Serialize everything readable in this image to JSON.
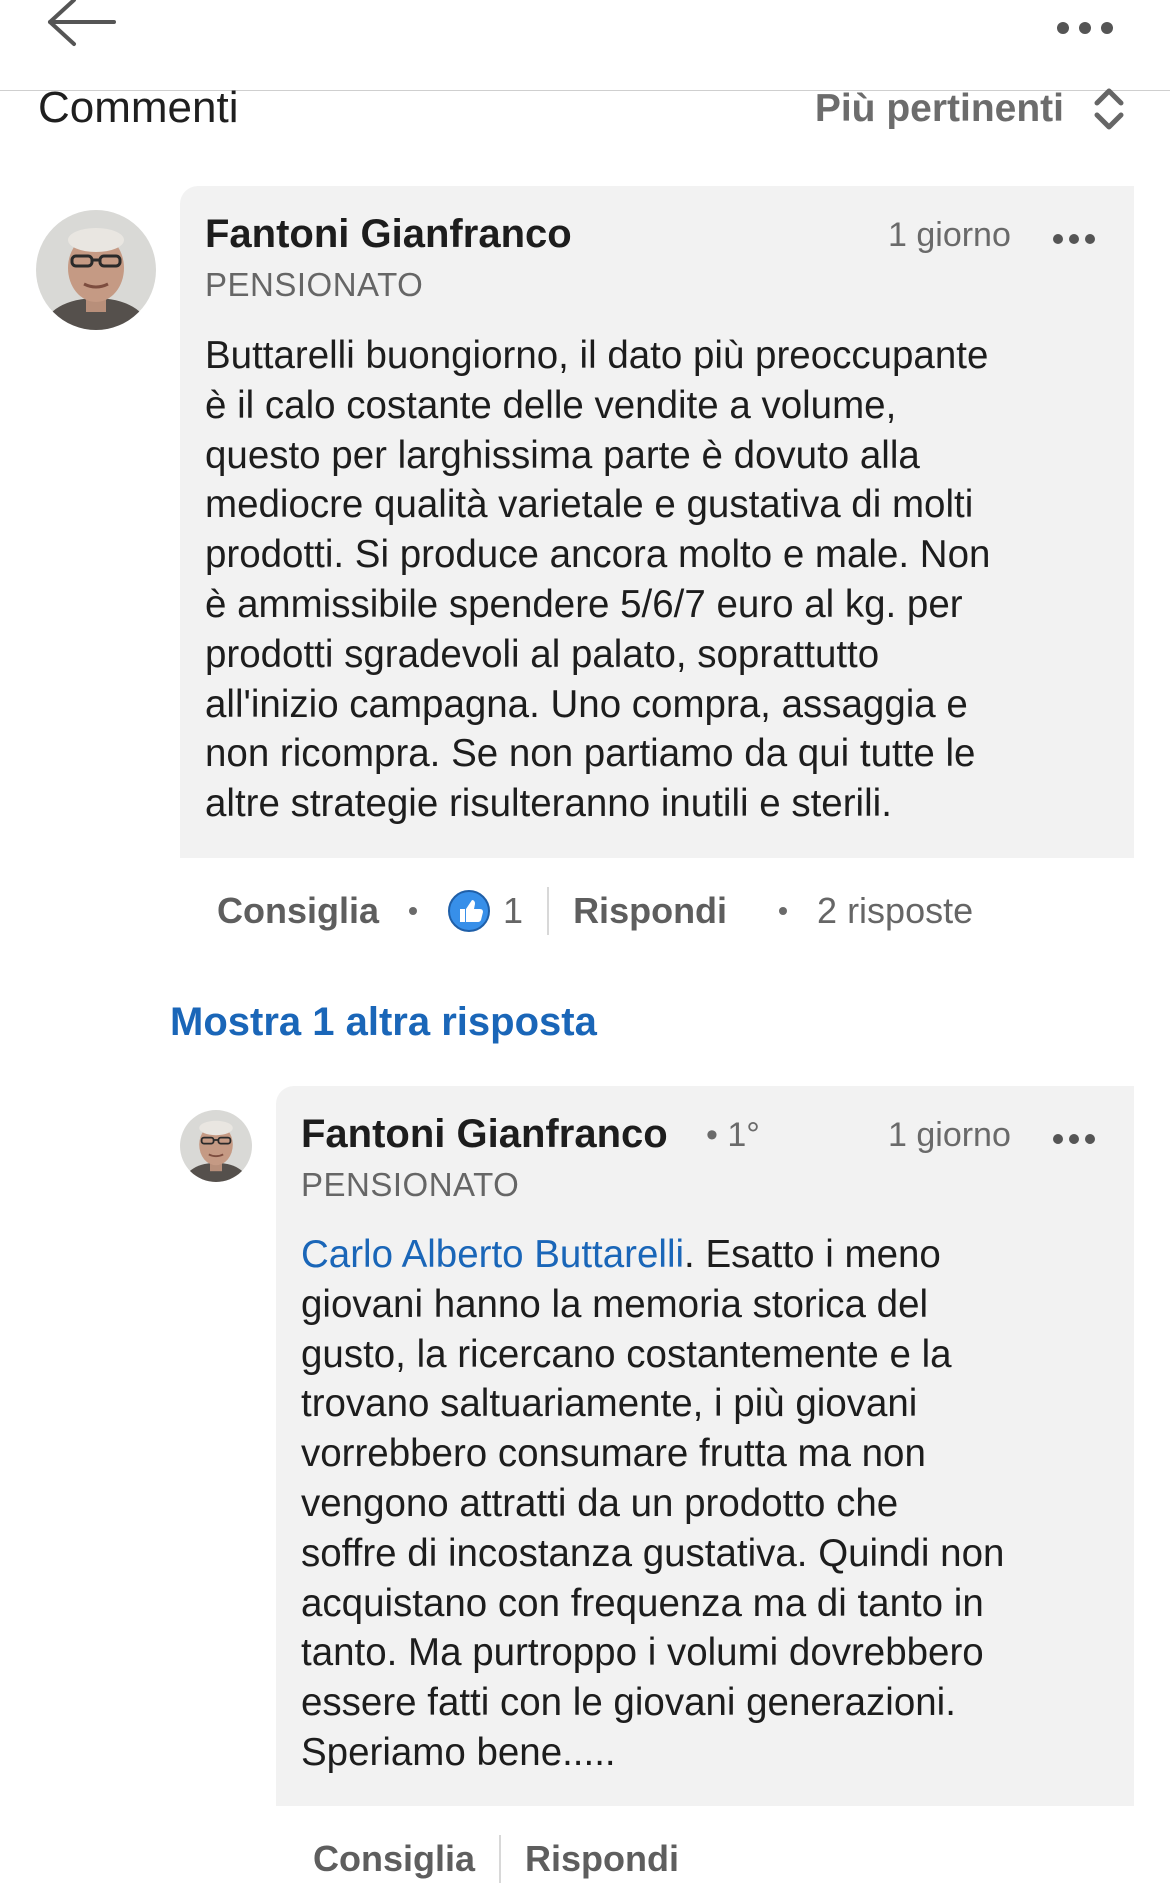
{
  "header": {
    "back_icon": "arrow-left-icon",
    "more_icon": "more-horizontal-icon"
  },
  "comments_section": {
    "title": "Commenti",
    "sort_label": "Più pertinenti",
    "sort_icon": "sort-updown-icon"
  },
  "comment": {
    "author": "Fantoni Gianfranco",
    "headline": "PENSIONATO",
    "time": "1 giorno",
    "text": "Buttarelli buongiorno, il dato più preoccupante\nè il calo costante delle vendite a volume,\nquesto per larghissima parte è dovuto alla\nmediocre qualità varietale e gustativa di molti\nprodotti. Si produce ancora molto e male. Non\nè ammissibile spendere 5/6/7 euro al kg. per\nprodotti sgradevoli al palato, soprattutto\nall'inizio campagna. Uno compra, assaggia e\nnon ricompra. Se non partiamo da qui tutte le\naltre strategie risulteranno inutili e sterili.",
    "actions": {
      "like_label": "Consiglia",
      "like_count": "1",
      "reply_label": "Rispondi",
      "replies_count": "2 risposte"
    }
  },
  "show_more_replies": "Mostra 1 altra risposta",
  "reply": {
    "author": "Fantoni Gianfranco",
    "degree": "• 1°",
    "headline": "PENSIONATO",
    "time": "1 giorno",
    "mention": "Carlo Alberto Buttarelli",
    "text": ". Esatto i meno\ngiovani hanno la memoria storica del\ngusto, la ricercano costantemente e la\ntrovano saltuariamente, i più giovani\nvorrebbero consumare frutta ma non\nvengono attratti da un prodotto che\nsoffre di incostanza gustativa. Quindi non\nacquistano con frequenza ma di tanto in\ntanto. Ma purtroppo i volumi dovrebbero\nessere fatti con le giovani generazioni.\nSperiamo bene.....",
    "actions": {
      "like_label": "Consiglia",
      "reply_label": "Rispondi"
    }
  },
  "colors": {
    "link_blue": "#1a66b8",
    "bubble_bg": "#f2f2f2",
    "like_badge_blue": "#378fe9"
  }
}
